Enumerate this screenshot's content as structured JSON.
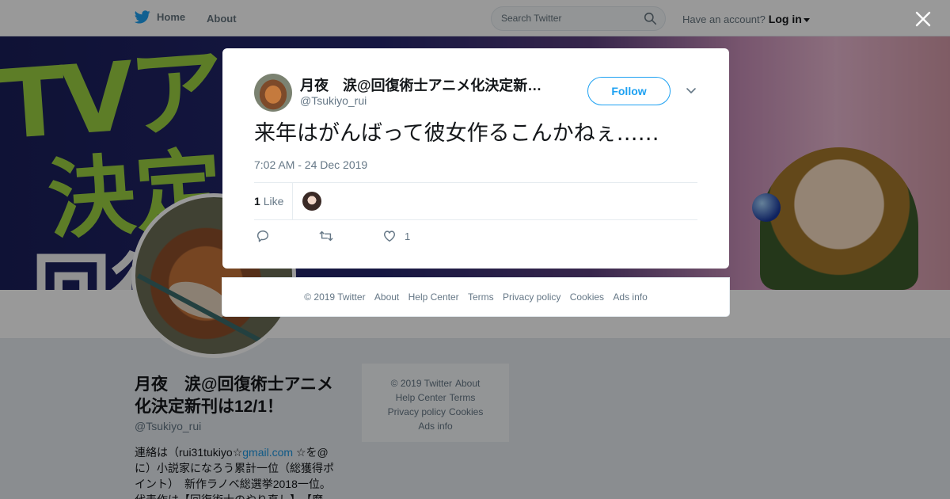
{
  "colors": {
    "accent": "#1da1f2",
    "text": "#14171a",
    "muted": "#657786",
    "bio_link": "#1b95e0"
  },
  "nav": {
    "home_label": "Home",
    "about_label": "About",
    "search_placeholder": "Search Twitter",
    "have_account": "Have an account?",
    "login_label": "Log in",
    "logo_icon": "twitter-bird-icon",
    "search_icon": "search-icon"
  },
  "banner": {
    "line1": "TVア",
    "line2": "決定",
    "line3": "回復"
  },
  "profile": {
    "name": "月夜　涙@回復術士アニメ化決定新刊は12/1！",
    "handle": "@Tsukiyo_rui",
    "bio_prefix": "連絡は（rui31tukiyo☆",
    "bio_link": "gmail.com",
    "bio_rest": " ☆を@に）小説家になろう累計一位（総獲得ポイント）　新作ラノベ総選挙2018一位。代表作は【回復術士のやり直し】、【魔"
  },
  "side_footer": {
    "copyright": "© 2019 Twitter",
    "about": "About",
    "help": "Help Center",
    "terms": "Terms",
    "privacy": "Privacy policy",
    "cookies": "Cookies",
    "ads": "Ads info"
  },
  "tweet": {
    "author_name": "月夜　涙@回復術士アニメ化決定新…",
    "author_handle": "@Tsukiyo_rui",
    "follow_label": "Follow",
    "text": "来年はがんばって彼女作るこんかねぇ……",
    "timestamp": "7:02 AM - 24 Dec 2019",
    "likes_count": "1",
    "likes_label": "Like",
    "action_like_count": "1",
    "icons": {
      "reply": "reply-icon",
      "retweet": "retweet-icon",
      "like": "heart-icon",
      "more": "chevron-down-icon",
      "close": "close-icon"
    }
  },
  "modal_footer": {
    "copyright": "© 2019 Twitter",
    "about": "About",
    "help": "Help Center",
    "terms": "Terms",
    "privacy": "Privacy policy",
    "cookies": "Cookies",
    "ads": "Ads info"
  }
}
